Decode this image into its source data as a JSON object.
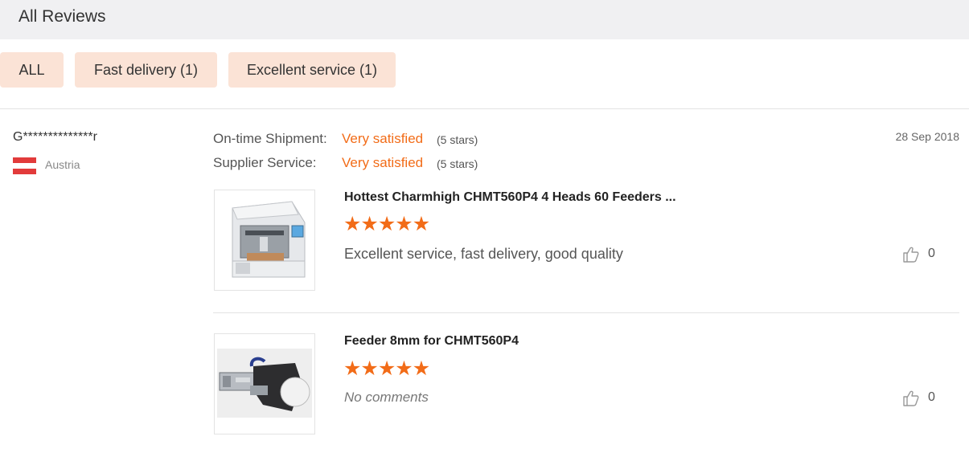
{
  "header": {
    "title": "All Reviews"
  },
  "filters": [
    {
      "label": "ALL"
    },
    {
      "label": "Fast delivery (1)"
    },
    {
      "label": "Excellent service (1)"
    }
  ],
  "review": {
    "reviewer": "G**************r",
    "country": "Austria",
    "date": "28 Sep 2018",
    "ratings": [
      {
        "label": "On-time Shipment:",
        "value": "Very satisfied",
        "stars": "(5 stars)"
      },
      {
        "label": "Supplier Service:",
        "value": "Very satisfied",
        "stars": "(5 stars)"
      }
    ],
    "products": [
      {
        "title": "Hottest Charmhigh CHMT560P4 4 Heads 60 Feeders ...",
        "rating": 5,
        "comment": "Excellent service, fast delivery, good quality",
        "likes": "0",
        "image_icon": "pick-and-place-machine-image"
      },
      {
        "title": "Feeder 8mm for CHMT560P4",
        "rating": 5,
        "comment": "No comments",
        "likes": "0",
        "image_icon": "feeder-image"
      }
    ]
  },
  "colors": {
    "accent": "#f26c18",
    "filter_bg": "#fbe3d6",
    "header_bg": "#f0f0f2"
  }
}
